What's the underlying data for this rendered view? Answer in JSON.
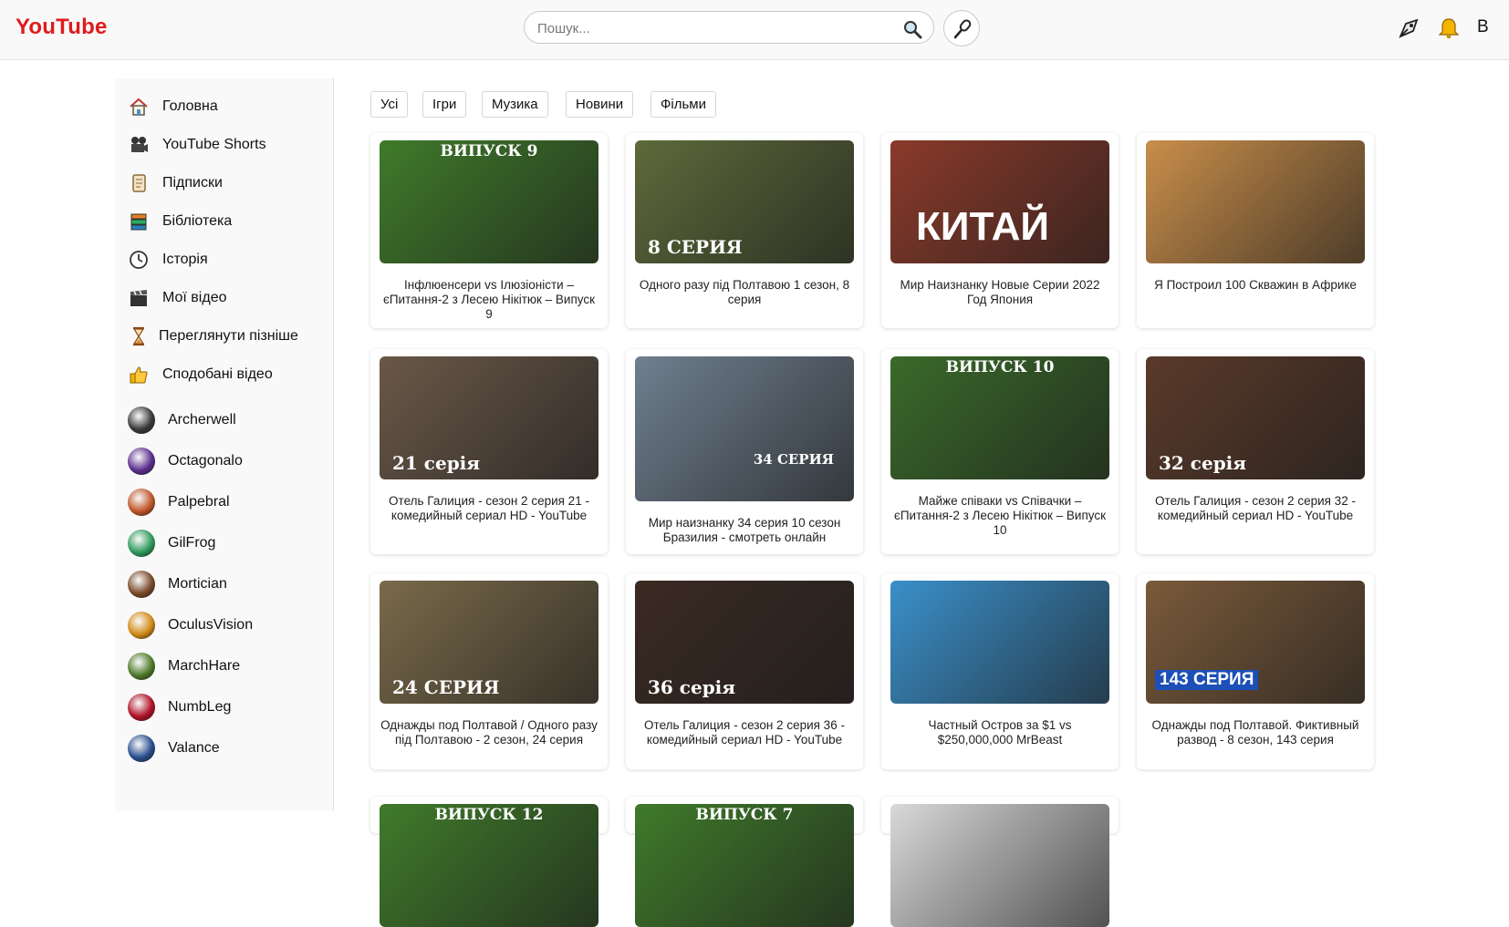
{
  "header": {
    "logo": "YouTube",
    "search_placeholder": "Пошук...",
    "avatar_letter": "B"
  },
  "sidebar": {
    "nav": [
      {
        "label": "Головна",
        "icon": "home-icon"
      },
      {
        "label": "YouTube Shorts",
        "icon": "film-camera-icon"
      },
      {
        "label": "Підписки",
        "icon": "scroll-icon"
      },
      {
        "label": "Бібліотека",
        "icon": "books-icon"
      },
      {
        "label": "Історія",
        "icon": "clock-icon"
      },
      {
        "label": "Мої відео",
        "icon": "clapperboard-icon"
      },
      {
        "label": "Переглянути пізніше",
        "icon": "hourglass-icon"
      },
      {
        "label": "Сподобані відео",
        "icon": "thumbs-up-icon"
      }
    ],
    "subscriptions": [
      {
        "label": "Archerwell",
        "color": "#3a3a3a"
      },
      {
        "label": "Octagonalo",
        "color": "#5b2f8f"
      },
      {
        "label": "Palpebral",
        "color": "#c0562a"
      },
      {
        "label": "GilFrog",
        "color": "#2f9a5c"
      },
      {
        "label": "Mortician",
        "color": "#7a4a2a"
      },
      {
        "label": "OculusVision",
        "color": "#d08a16"
      },
      {
        "label": "MarchHare",
        "color": "#4f7a2a"
      },
      {
        "label": "NumbLeg",
        "color": "#b01226"
      },
      {
        "label": "Valance",
        "color": "#2a4f8f"
      }
    ]
  },
  "chips": [
    "Усі",
    "Ігри",
    "Музика",
    "Новини",
    "Фільми"
  ],
  "videos": [
    {
      "title": "Інфлюенсери vs Ілюзіоністи – єПитання-2 з Лесею Нікітюк – Випуск 9",
      "badge": "ВИПУСК 9",
      "bg": "#3f7a2a"
    },
    {
      "title": "Одного разу під Полтавою 1 сезон, 8 серия",
      "badge": "8 СЕРИЯ",
      "bg": "#5d6a3a"
    },
    {
      "title": "Мир Наизнанку Новые Серии 2022 Год Япония",
      "badge": "КИТАЙ",
      "bg": "#8a3a2a"
    },
    {
      "title": "Я Построил 100 Скважин в Африке",
      "badge": "",
      "bg": "#c98e4a"
    },
    {
      "title": "Отель Галиция - сезон 2 серия 21 - комедийный сериал HD - YouTube",
      "badge": "21 серія",
      "bg": "#6a5848"
    },
    {
      "title": "Мир наизнанку 34 серия 10 сезон Бразилия - смотреть онлайн",
      "badge": "34 СЕРИЯ",
      "bg": "#6f7f8f"
    },
    {
      "title": "Майже співаки vs Співачки – єПитання-2 з Лесею Нікітюк – Випуск 10",
      "badge": "ВИПУСК 10",
      "bg": "#3a6a2a"
    },
    {
      "title": "Отель Галиция - сезон 2 серия 32 - комедийный сериал HD - YouTube",
      "badge": "32 серія",
      "bg": "#5a3a2a"
    },
    {
      "title": "Однажды под Полтавой / Одного разу під Полтавою - 2 сезон, 24 серия",
      "badge": "24 СЕРИЯ",
      "bg": "#7a6a4a"
    },
    {
      "title": "Отель Галиция - сезон 2 серия 36 - комедийный сериал HD - YouTube",
      "badge": "36 серія",
      "bg": "#3a2a22"
    },
    {
      "title": "Частный Остров за $1 vs $250,000,000 MrBeast",
      "badge": "",
      "bg": "#3a8fc9"
    },
    {
      "title": "Однажды под Полтавой. Фиктивный развод - 8 сезон, 143 серия",
      "badge": "143 СЕРИЯ",
      "bg": "#7a5a3a"
    },
    {
      "title": "",
      "badge": "ВИПУСК 12",
      "bg": "#3f7a2a"
    },
    {
      "title": "",
      "badge": "ВИПУСК 7",
      "bg": "#3f7a2a"
    },
    {
      "title": "",
      "badge": "",
      "bg": "#d9d9d9"
    }
  ]
}
